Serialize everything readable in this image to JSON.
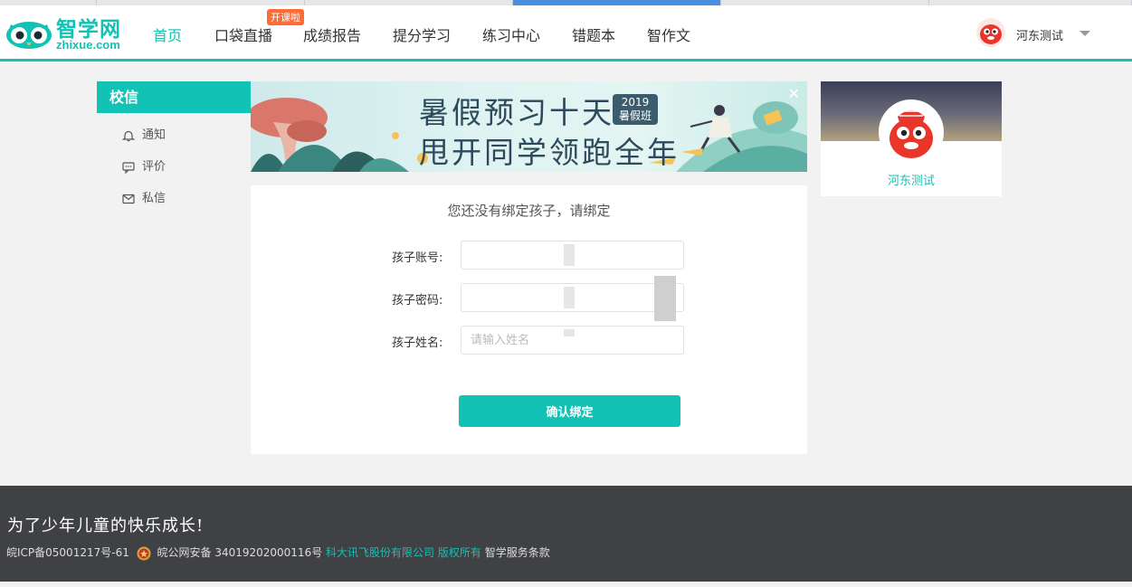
{
  "header": {
    "logo_cn": "智学网",
    "logo_en": "zhixue.com",
    "nav": [
      {
        "label": "首页",
        "active": true
      },
      {
        "label": "口袋直播",
        "badge": "开课啦"
      },
      {
        "label": "成绩报告"
      },
      {
        "label": "提分学习"
      },
      {
        "label": "练习中心"
      },
      {
        "label": "错题本"
      },
      {
        "label": "智作文"
      }
    ],
    "user_name": "河东测试"
  },
  "sidebar": {
    "title": "校信",
    "items": [
      {
        "label": "通知",
        "icon": "bell-icon"
      },
      {
        "label": "评价",
        "icon": "comment-icon"
      },
      {
        "label": "私信",
        "icon": "mail-icon"
      }
    ]
  },
  "banner": {
    "line1": "暑假预习十天",
    "line2": "甩开同学领跑全年",
    "tag_year": "2019",
    "tag_text": "暑假班",
    "close_symbol": "✕"
  },
  "bind_form": {
    "title": "您还没有绑定孩子，请绑定",
    "account_label": "孩子账号:",
    "password_label": "孩子密码:",
    "name_label": "孩子姓名:",
    "name_placeholder": "请输入姓名",
    "submit_label": "确认绑定"
  },
  "profile": {
    "name": "河东测试"
  },
  "footer": {
    "slogan": "为了少年儿童的快乐成长!",
    "icp": "皖ICP备05001217号-61",
    "police": "皖公网安备 34019202000116号",
    "company": "科大讯飞股份有限公司 版权所有",
    "terms": "智学服务条款"
  },
  "colors": {
    "accent": "#12c2b4",
    "badge": "#ff6b35",
    "footer_bg": "#404145"
  }
}
